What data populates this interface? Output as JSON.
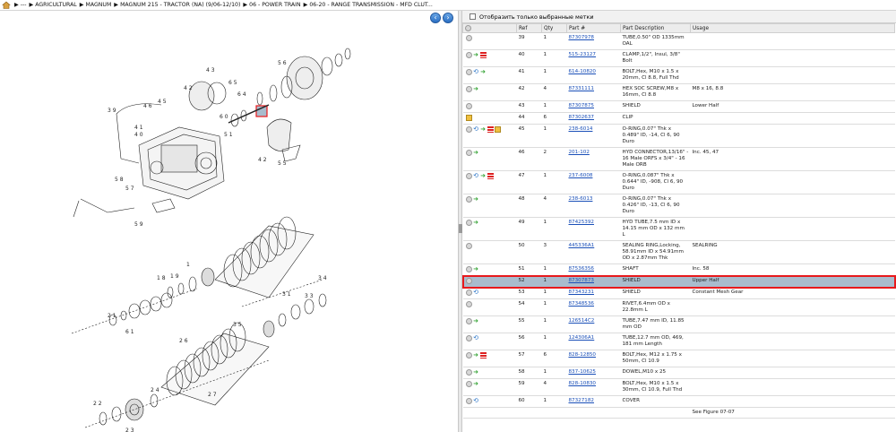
{
  "breadcrumb": {
    "home_icon": "home-icon",
    "items": [
      "---",
      "AGRICULTURAL",
      "MAGNUM",
      "MAGNUM 215 - TRACTOR (NA) (9/06-12/10)",
      "06 - POWER TRAIN",
      "06-20 - RANGE TRANSMISSION - MFD CLUT..."
    ]
  },
  "nav": {
    "back_icon": "arrow-left-icon",
    "forward_icon": "arrow-right-icon"
  },
  "filter": {
    "label": "Отобразить только выбранные метки"
  },
  "table": {
    "headers": [
      "Ref",
      "Qty",
      "Part #",
      "Part Description",
      "Usage"
    ],
    "rows": [
      {
        "ref": "39",
        "qty": "1",
        "part": "87307978",
        "desc": "TUBE,0.50\" OD 1335mm OAL",
        "usage": "",
        "icons": [
          "circle"
        ],
        "h": 2
      },
      {
        "ref": "40",
        "qty": "1",
        "part": "515-23127",
        "desc": "CLAMP,1/2\", Insul, 3/8\" Bolt",
        "usage": "",
        "icons": [
          "circle",
          "arrow",
          "flag"
        ],
        "h": 1
      },
      {
        "ref": "41",
        "qty": "1",
        "part": "614-10820",
        "desc": "BOLT,Hex, M10 x 1.5 x 20mm, Cl 8.8, Full Thd",
        "usage": "",
        "icons": [
          "circle",
          "swap",
          "arrow"
        ],
        "h": 2
      },
      {
        "ref": "42",
        "qty": "4",
        "part": "87331111",
        "desc": "HEX SOC SCREW,M8 x 16mm, Cl 8.8",
        "usage": "M8 x 16, 8.8",
        "icons": [
          "circle",
          "arrow"
        ],
        "h": 2
      },
      {
        "ref": "43",
        "qty": "1",
        "part": "87307875",
        "desc": "SHIELD",
        "usage": "Lower Half",
        "icons": [
          "circle"
        ],
        "h": 0
      },
      {
        "ref": "44",
        "qty": "6",
        "part": "87302637",
        "desc": "CLIP",
        "usage": "",
        "icons": [
          "box"
        ],
        "h": 0
      },
      {
        "ref": "45",
        "qty": "1",
        "part": "238-6014",
        "desc": "O-RING,0.07\" Thk x 0.489\" ID, -14, Cl 6, 90 Duro",
        "usage": "",
        "icons": [
          "circle",
          "swap",
          "arrow",
          "flag",
          "box"
        ],
        "h": 2
      },
      {
        "ref": "46",
        "qty": "2",
        "part": "201-102",
        "desc": "HYD CONNECTOR,13/16\" - 16 Male ORFS x 3/4\" - 16 Male ORB",
        "usage": "Inc. 45, 47",
        "icons": [
          "circle",
          "arrow"
        ],
        "h": 3
      },
      {
        "ref": "47",
        "qty": "1",
        "part": "237-6008",
        "desc": "O-RING,0.087\" Thk x 0.644\" ID, -908, Cl 6, 90 Duro",
        "usage": "",
        "icons": [
          "circle",
          "swap",
          "arrow",
          "flag"
        ],
        "h": 2
      },
      {
        "ref": "48",
        "qty": "4",
        "part": "238-6013",
        "desc": "O-RING,0.07\" Thk x 0.426\" ID, -13, Cl 6, 90 Duro",
        "usage": "",
        "icons": [
          "circle",
          "arrow"
        ],
        "h": 2
      },
      {
        "ref": "49",
        "qty": "1",
        "part": "87425392",
        "desc": "HYD TUBE,7.5 mm ID x 14.15 mm OD x 132 mm L",
        "usage": "",
        "icons": [
          "circle",
          "arrow"
        ],
        "h": 2
      },
      {
        "ref": "50",
        "qty": "3",
        "part": "445336A1",
        "desc": "SEALING RING,Locking, 58.91mm ID x 54.91mm OD x 2.87mm Thk",
        "usage": "SEALRING",
        "icons": [
          "circle"
        ],
        "h": 3
      },
      {
        "ref": "51",
        "qty": "1",
        "part": "87536356",
        "desc": "SHAFT",
        "usage": "Inc. 58",
        "icons": [
          "circle",
          "arrow"
        ],
        "h": 0
      },
      {
        "ref": "52",
        "qty": "1",
        "part": "87307873",
        "desc": "SHIELD",
        "usage": "Upper Half",
        "icons": [
          "circle"
        ],
        "h": 0,
        "selected": true
      },
      {
        "ref": "53",
        "qty": "1",
        "part": "87343231",
        "desc": "SHIELD",
        "usage": "Constant Mesh Gear",
        "icons": [
          "circle",
          "swap"
        ],
        "h": 0
      },
      {
        "ref": "54",
        "qty": "1",
        "part": "87348536",
        "desc": "RIVET,6.4mm OD x 22.8mm L",
        "usage": "",
        "icons": [
          "circle"
        ],
        "h": 2
      },
      {
        "ref": "55",
        "qty": "1",
        "part": "126514C2",
        "desc": "TUBE,7.47 mm ID, 11.85 mm OD",
        "usage": "",
        "icons": [
          "circle",
          "arrow"
        ],
        "h": 2
      },
      {
        "ref": "56",
        "qty": "1",
        "part": "124306A1",
        "desc": "TUBE,12.7 mm OD, 469, 181 mm Length",
        "usage": "",
        "icons": [
          "circle",
          "swap"
        ],
        "h": 2
      },
      {
        "ref": "57",
        "qty": "6",
        "part": "828-12850",
        "desc": "BOLT,Hex, M12 x 1.75 x 50mm, Cl 10.9",
        "usage": "",
        "icons": [
          "circle",
          "arrow",
          "flag"
        ],
        "h": 2
      },
      {
        "ref": "58",
        "qty": "1",
        "part": "837-10625",
        "desc": "DOWEL,M10 x 25",
        "usage": "",
        "icons": [
          "circle",
          "arrow"
        ],
        "h": 0
      },
      {
        "ref": "59",
        "qty": "4",
        "part": "828-10830",
        "desc": "BOLT,Hex, M10 x 1.5 x 30mm, Cl 10.9, Full Thd",
        "usage": "",
        "icons": [
          "circle",
          "arrow"
        ],
        "h": 2
      },
      {
        "ref": "60",
        "qty": "1",
        "part": "87327182",
        "desc": "COVER",
        "usage": "",
        "icons": [
          "circle",
          "swap"
        ],
        "h": 0
      },
      {
        "ref": "",
        "qty": "",
        "part": "",
        "desc": "",
        "usage": "See Figure 07-07",
        "icons": [],
        "h": 0
      }
    ]
  },
  "diagram": {
    "callouts": [
      "1",
      "4",
      "6",
      "18",
      "19",
      "20",
      "21",
      "22",
      "23",
      "24",
      "26",
      "27",
      "31",
      "32",
      "33",
      "34",
      "35",
      "36",
      "37",
      "38",
      "39",
      "40",
      "41",
      "42",
      "43",
      "44",
      "45",
      "46",
      "47",
      "48",
      "49",
      "50",
      "51",
      "52",
      "53",
      "54",
      "55",
      "56",
      "57",
      "58",
      "59",
      "60",
      "61",
      "62",
      "63",
      "64",
      "65"
    ]
  }
}
